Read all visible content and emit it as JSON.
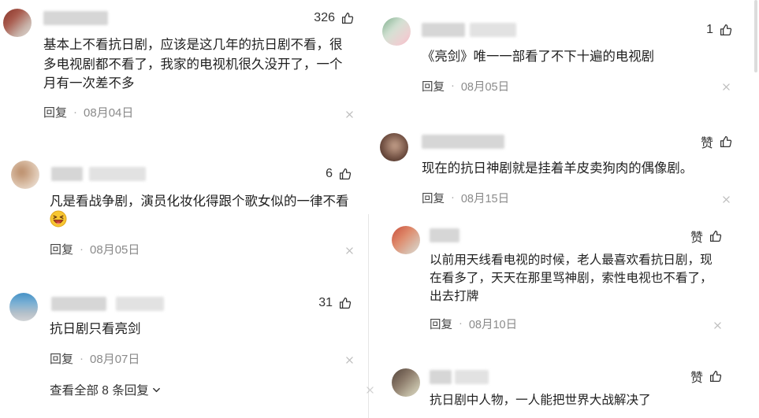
{
  "labels": {
    "reply": "回复",
    "separator": "·",
    "view_all_replies": "查看全部 8 条回复"
  },
  "left": {
    "comments": [
      {
        "like_display": "326",
        "lines": [
          "基本上不看抗日剧，应该是这几年的抗日剧不看，很",
          "多电视剧都不看了，我家的电视机很久没开了，一个",
          "月有一次差不多"
        ],
        "date": "08月04日"
      },
      {
        "like_display": "6",
        "lines": [
          "凡是看战争剧，演员化妆化得跟个歌女似的一律不看"
        ],
        "emoji": "laughing-face",
        "date": "08月05日"
      },
      {
        "like_display": "31",
        "lines": [
          "抗日剧只看亮剑"
        ],
        "date": "08月07日"
      }
    ]
  },
  "right": {
    "comments": [
      {
        "like_display": "1",
        "lines": [
          "《亮剑》唯一一部看了不下十遍的电视剧"
        ],
        "date": "08月05日"
      },
      {
        "like_display": "赞",
        "lines": [
          "现在的抗日神剧就是挂着羊皮卖狗肉的偶像剧。"
        ],
        "date": "08月15日"
      },
      {
        "like_display": "赞",
        "lines": [
          "以前用天线看电视的时候，老人最喜欢看抗日剧，现",
          "在看多了，天天在那里骂神剧，索性电视也不看了，",
          "出去打牌"
        ],
        "date": "08月10日"
      },
      {
        "like_display": "赞",
        "lines": [
          "抗日剧中人物，一人能把世界大战解决了"
        ]
      }
    ]
  },
  "icons": {
    "like": "thumbs-up",
    "close": "close",
    "expand": "chevron-down",
    "avatar": "blurred-avatar",
    "username": "blurred-username"
  },
  "colors": {
    "background": "#ffffff",
    "text": "#1f1f1f",
    "meta": "#444444",
    "date": "#8a8a8a",
    "close": "#bbbbbb"
  }
}
